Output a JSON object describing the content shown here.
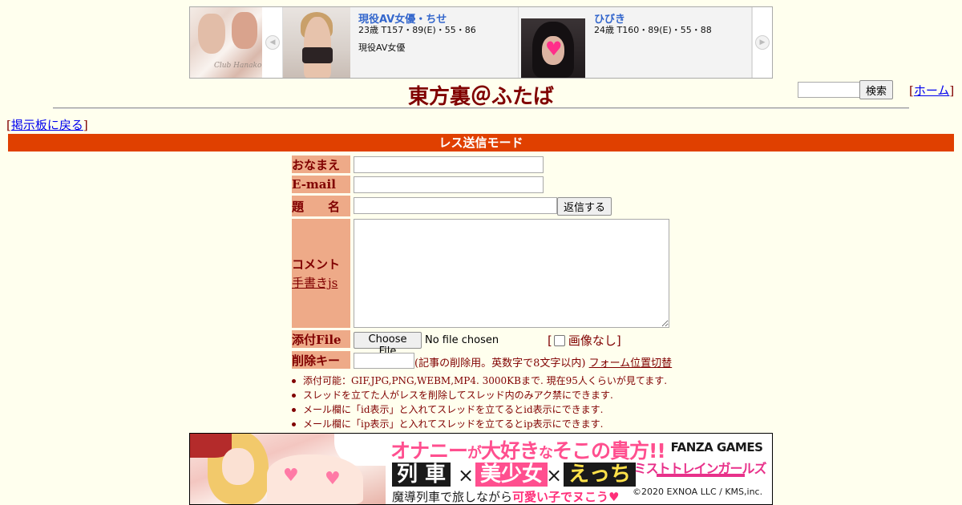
{
  "ad_strip": {
    "logo_signature": "Club Hanako",
    "profiles": [
      {
        "name": "現役AV女優・ちせ",
        "stats": "23歳 T157・89(E)・55・86",
        "desc": "現役AV女優"
      },
      {
        "name": "ひびき",
        "stats": "24歳 T160・89(E)・55・88",
        "desc": ""
      }
    ],
    "prev_glyph": "◀",
    "next_glyph": "▶"
  },
  "header": {
    "title": "東方裏＠ふたば",
    "search_button": "検索",
    "home_link": "ホーム",
    "bracket_open": "[",
    "bracket_close": "]"
  },
  "nav": {
    "back_link": "掲示板に戻る"
  },
  "mode_bar": "レス送信モード",
  "form": {
    "name_label": "おなまえ",
    "email_label": "E-mail",
    "subject_label": "題　　名",
    "comment_label": "コメント",
    "handwriting_link": "手書きjs",
    "file_label": "添付File",
    "delkey_label": "削除キー",
    "submit_button": "返信する",
    "choose_file_button": "Choose File",
    "file_status": "No file chosen",
    "noimage_label": "画像なし",
    "delkey_note": "(記事の削除用。英数字で8文字以内)",
    "form_position_link": "フォーム位置切替"
  },
  "notes": [
    "添付可能：GIF,JPG,PNG,WEBM,MP4. 3000KBまで. 現在95人くらいが見てます.",
    "スレッドを立てた人がレスを削除してスレッド内のみアク禁にできます.",
    "メール欄に「id表示」と入れてスレッドを立てるとid表示にできます.",
    "メール欄に「ip表示」と入れてスレッドを立てるとip表示にできます."
  ],
  "banner": {
    "tagline_prefix": "オナニー",
    "tagline_small_1": "が",
    "tagline_mid": "大好き",
    "tagline_small_2": "な",
    "tagline_end": "そこの貴方!!",
    "kw_train": "列 車",
    "kw_girl": "美少女",
    "kw_ecchi": "えっち",
    "times": "×",
    "sub_prefix": "魔導列車で旅しながら",
    "sub_highlight": "可愛い子でヌこう♥",
    "publisher": "FANZA GAMES",
    "game_title": "ミストトレインガールズ",
    "copyright": "©2020 EXNOA LLC / KMS,inc."
  },
  "colors": {
    "background": "#ffffee",
    "text": "#800000",
    "mode_bar": "#e04000",
    "label_bg": "#eeaa88",
    "link": "#0000ee"
  }
}
